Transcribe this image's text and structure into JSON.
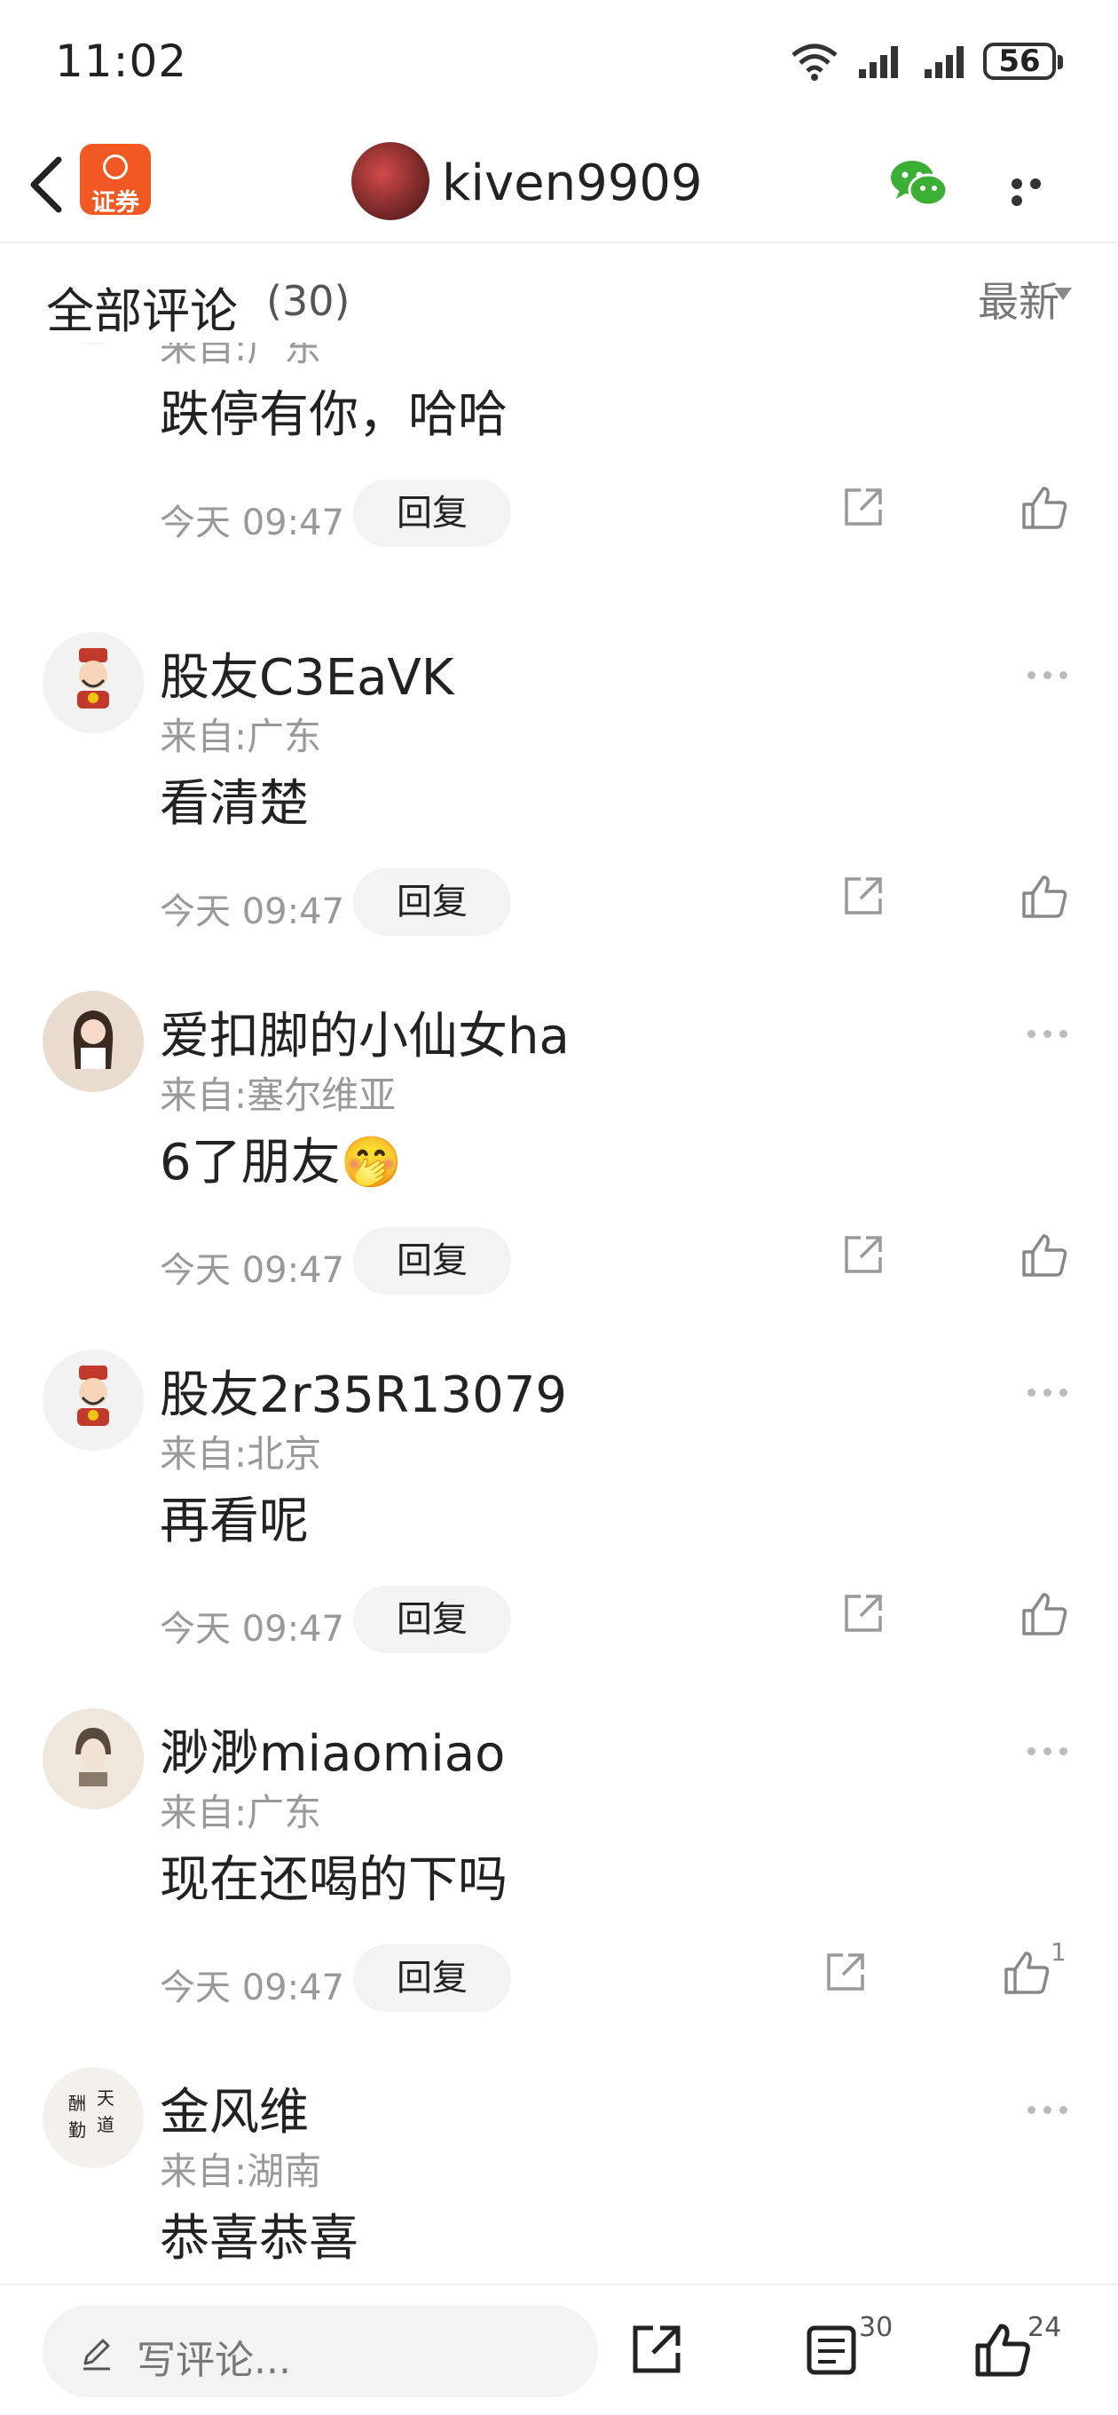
{
  "status": {
    "time": "11:02",
    "battery": "56"
  },
  "nav": {
    "brand_label": "证券",
    "username": "kiven9909"
  },
  "header": {
    "title": "全部评论",
    "count": "(30)",
    "sort": "最新"
  },
  "comments": [
    {
      "name": "",
      "loc": "来自:广东",
      "text": "跌停有你，哈哈",
      "time": "今天 09:47",
      "reply": "回复",
      "likes": ""
    },
    {
      "name": "股友C3EaVK",
      "loc": "来自:广东",
      "text": "看清楚",
      "time": "今天 09:47",
      "reply": "回复",
      "likes": ""
    },
    {
      "name": "爱扣脚的小仙女ha",
      "loc": "来自:塞尔维亚",
      "text": "6了朋友🤭",
      "time": "今天 09:47",
      "reply": "回复",
      "likes": ""
    },
    {
      "name": "股友2r35R13079",
      "loc": "来自:北京",
      "text": "再看呢",
      "time": "今天 09:47",
      "reply": "回复",
      "likes": ""
    },
    {
      "name": "渺渺miaomiao",
      "loc": "来自:广东",
      "text": "现在还喝的下吗",
      "time": "今天 09:47",
      "reply": "回复",
      "likes": "1"
    },
    {
      "name": "金风维",
      "loc": "来自:湖南",
      "text": "恭喜恭喜",
      "time": "",
      "reply": "",
      "likes": ""
    }
  ],
  "bottom": {
    "placeholder": "写评论...",
    "comment_count": "30",
    "like_count": "24"
  },
  "colors": {
    "accent": "#f25822",
    "wechat": "#3cb034"
  }
}
